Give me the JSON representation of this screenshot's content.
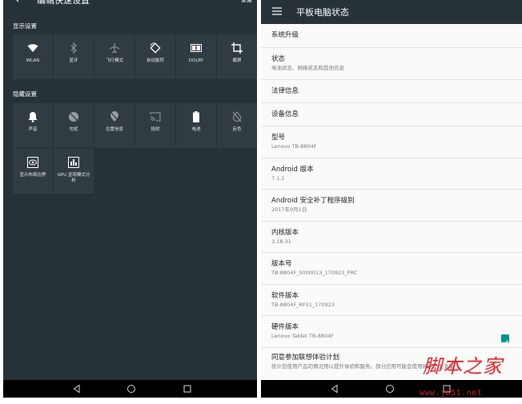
{
  "left": {
    "title": "编辑快速设置",
    "reset_label": "重置",
    "section_display": "显示设置",
    "section_hidden": "隐藏设置",
    "display_tiles": [
      {
        "label": "WLAN",
        "icon": "wifi-icon"
      },
      {
        "label": "蓝牙",
        "icon": "bluetooth-icon"
      },
      {
        "label": "飞行模式",
        "icon": "airplane-icon"
      },
      {
        "label": "自动旋转",
        "icon": "rotate-icon"
      },
      {
        "label": "DOLBY",
        "icon": "dolby-icon"
      },
      {
        "label": "截屏",
        "icon": "crop-icon"
      }
    ],
    "hidden_tiles": [
      {
        "label": "声音",
        "icon": "bell-icon"
      },
      {
        "label": "勿扰",
        "icon": "do-not-disturb-icon"
      },
      {
        "label": "位置信息",
        "icon": "location-icon"
      },
      {
        "label": "投射",
        "icon": "cast-icon"
      },
      {
        "label": "电池",
        "icon": "battery-icon"
      },
      {
        "label": "反色",
        "icon": "invert-colors-icon"
      },
      {
        "label": "显示布局边界",
        "icon": "layout-bounds-icon"
      },
      {
        "label": "GPU 呈现模式分析",
        "icon": "gpu-profile-icon"
      }
    ]
  },
  "right": {
    "title": "平板电脑状态",
    "items": [
      {
        "title": "系统升级",
        "subtitle": ""
      },
      {
        "title": "状态",
        "subtitle": "电池状态、网络状态和其他信息"
      },
      {
        "title": "法律信息",
        "subtitle": ""
      },
      {
        "title": "设备信息",
        "subtitle": ""
      },
      {
        "title": "型号",
        "subtitle": "Lenovo TB-8804F"
      },
      {
        "title": "Android 版本",
        "subtitle": "7.1.1"
      },
      {
        "title": "Android 安全补丁程序级别",
        "subtitle": "2017年9月1日"
      },
      {
        "title": "内核版本",
        "subtitle": "3.18.31"
      },
      {
        "title": "版本号",
        "subtitle": "TB-8804F_S000013_170923_PRC"
      },
      {
        "title": "软件版本",
        "subtitle": "TB-8804F_RF01_170923"
      },
      {
        "title": "硬件版本",
        "subtitle": "Lenovo Tablet TB-8804F"
      },
      {
        "title": "同意参加联想体验计划",
        "subtitle": "统计您使用产品的情况用以提升体验和服务。部分应用可能会使用网络产生流量"
      }
    ],
    "checkbox_checked": true
  },
  "navbar_icons": [
    "back-icon",
    "home-icon",
    "recents-icon"
  ],
  "watermark": {
    "main": "脚本之家",
    "url": "www.jb51.net"
  },
  "colors": {
    "dark_panel": "#263238",
    "tile_bg": "#313c42",
    "accent": "#009688",
    "watermark": "#d8232a"
  }
}
